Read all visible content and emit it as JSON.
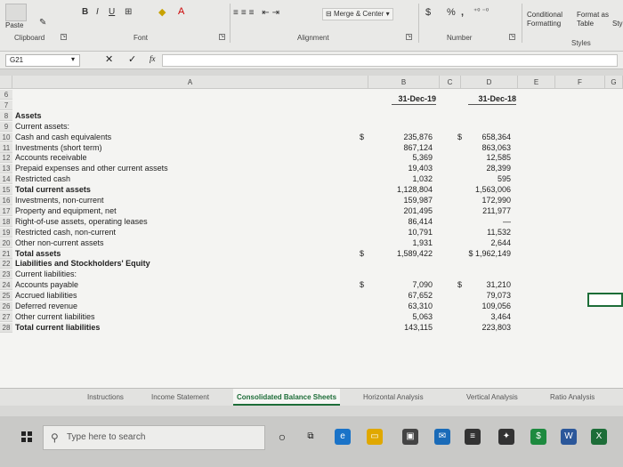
{
  "ribbon": {
    "paste": "Paste",
    "clipboard_label": "Clipboard",
    "font_label": "Font",
    "alignment_label": "Alignment",
    "number_label": "Number",
    "styles_label": "Styles",
    "merge_center": "Merge & Center",
    "currency": "$",
    "percent": "%",
    "comma": ",",
    "conditional_formatting": "Conditional Formatting",
    "format_as_table": "Format as Table",
    "cell_styles": "Sty"
  },
  "formula_bar": {
    "name_box": "G21",
    "fx": "fx"
  },
  "columns": [
    "A",
    "B",
    "C",
    "D",
    "E",
    "F",
    "G"
  ],
  "header_dates": {
    "b": "31-Dec-19",
    "d": "31-Dec-18"
  },
  "rows": [
    {
      "n": "6",
      "label": "",
      "cur1": "",
      "b": "",
      "cur2": "",
      "d": ""
    },
    {
      "n": "7",
      "label": "",
      "cur1": "",
      "b": "",
      "cur2": "",
      "d": ""
    },
    {
      "n": "8",
      "label": "Assets",
      "bold": true,
      "cur1": "",
      "b": "",
      "cur2": "",
      "d": ""
    },
    {
      "n": "9",
      "label": "Current assets:",
      "cur1": "",
      "b": "",
      "cur2": "",
      "d": ""
    },
    {
      "n": "10",
      "label": "Cash and cash equivalents",
      "cur1": "$",
      "b": "235,876",
      "cur2": "$",
      "d": "658,364"
    },
    {
      "n": "11",
      "label": "Investments (short term)",
      "cur1": "",
      "b": "867,124",
      "cur2": "",
      "d": "863,063"
    },
    {
      "n": "12",
      "label": "Accounts receivable",
      "cur1": "",
      "b": "5,369",
      "cur2": "",
      "d": "12,585"
    },
    {
      "n": "13",
      "label": "Prepaid expenses and other current assets",
      "cur1": "",
      "b": "19,403",
      "cur2": "",
      "d": "28,399"
    },
    {
      "n": "14",
      "label": "Restricted cash",
      "cur1": "",
      "b": "1,032",
      "cur2": "",
      "d": "595"
    },
    {
      "n": "15",
      "label": "Total current assets",
      "bold": true,
      "cur1": "",
      "b": "1,128,804",
      "cur2": "",
      "d": "1,563,006"
    },
    {
      "n": "16",
      "label": "Investments, non-current",
      "cur1": "",
      "b": "159,987",
      "cur2": "",
      "d": "172,990"
    },
    {
      "n": "17",
      "label": "Property and equipment, net",
      "cur1": "",
      "b": "201,495",
      "cur2": "",
      "d": "211,977"
    },
    {
      "n": "18",
      "label": "Right-of-use assets, operating leases",
      "cur1": "",
      "b": "86,414",
      "cur2": "",
      "d": "—"
    },
    {
      "n": "19",
      "label": "Restricted cash, non-current",
      "cur1": "",
      "b": "10,791",
      "cur2": "",
      "d": "11,532"
    },
    {
      "n": "20",
      "label": "Other non-current assets",
      "cur1": "",
      "b": "1,931",
      "cur2": "",
      "d": "2,644"
    },
    {
      "n": "21",
      "label": "Total assets",
      "bold": true,
      "cur1": "$",
      "b": "1,589,422",
      "cur2": "",
      "d": "$ 1,962,149"
    },
    {
      "n": "22",
      "label": "Liabilities and Stockholders' Equity",
      "bold": true,
      "cur1": "",
      "b": "",
      "cur2": "",
      "d": ""
    },
    {
      "n": "23",
      "label": "Current liabilities:",
      "cur1": "",
      "b": "",
      "cur2": "",
      "d": ""
    },
    {
      "n": "24",
      "label": "Accounts payable",
      "cur1": "$",
      "b": "7,090",
      "cur2": "$",
      "d": "31,210"
    },
    {
      "n": "25",
      "label": "Accrued liabilities",
      "cur1": "",
      "b": "67,652",
      "cur2": "",
      "d": "79,073"
    },
    {
      "n": "26",
      "label": "Deferred revenue",
      "cur1": "",
      "b": "63,310",
      "cur2": "",
      "d": "109,056"
    },
    {
      "n": "27",
      "label": "Other current liabilities",
      "cur1": "",
      "b": "5,063",
      "cur2": "",
      "d": "3,464"
    },
    {
      "n": "28",
      "label": "Total current liabilities",
      "bold": true,
      "cur1": "",
      "b": "143,115",
      "cur2": "",
      "d": "223,803"
    }
  ],
  "tabs": [
    "Instructions",
    "Income Statement",
    "Consolidated Balance Sheets",
    "Horizontal Analysis",
    "Vertical Analysis",
    "Ratio Analysis"
  ],
  "active_tab": "Consolidated Balance Sheets",
  "taskbar": {
    "search_placeholder": "Type here to search"
  },
  "colors": {
    "excel_green": "#1d6d38",
    "grid_bg": "#f4f4f2"
  }
}
